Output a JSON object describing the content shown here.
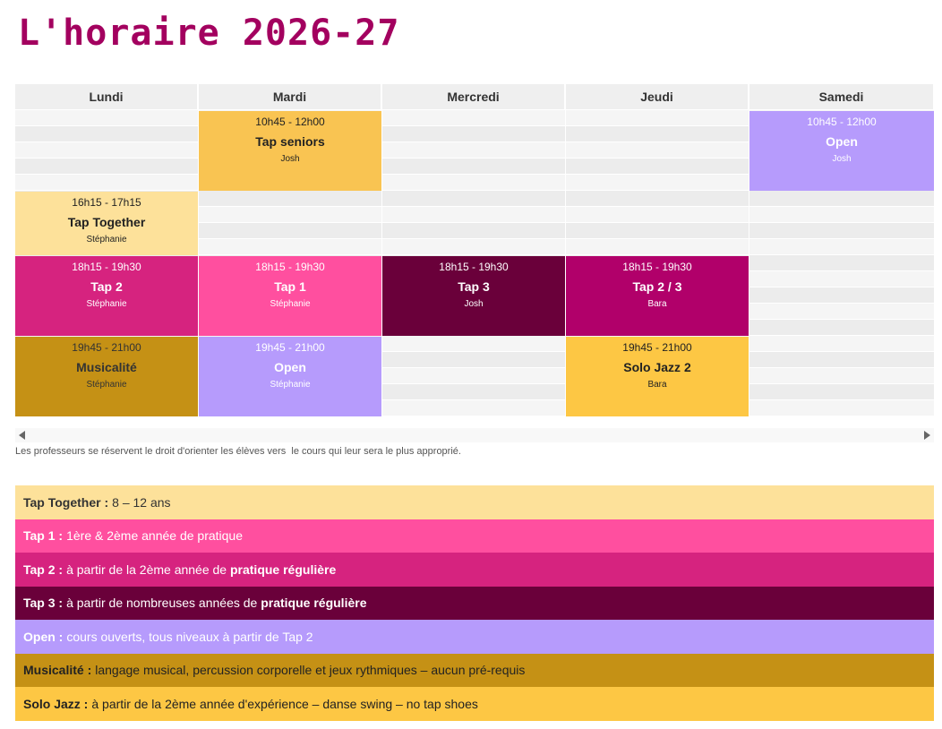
{
  "page": {
    "title": "L'horaire 2026-27"
  },
  "days": [
    "Lundi",
    "Mardi",
    "Mercredi",
    "Jeudi",
    "Samedi"
  ],
  "classes": [
    {
      "day": 1,
      "time": "10h45 - 12h00",
      "name": "Tap seniors",
      "teacher": "Josh",
      "bg": "#f9c452",
      "fg": "#222222"
    },
    {
      "day": 4,
      "time": "10h45 - 12h00",
      "name": "Open",
      "teacher": "Josh",
      "bg": "#b69bfc",
      "fg": "#ffffff"
    },
    {
      "day": 0,
      "time": "16h15 - 17h15",
      "name": "Tap Together",
      "teacher": "Stéphanie",
      "bg": "#fde19a",
      "fg": "#222222"
    },
    {
      "day": 0,
      "time": "18h15 - 19h30",
      "name": "Tap 2",
      "teacher": "Stéphanie",
      "bg": "#d6237f",
      "fg": "#ffffff"
    },
    {
      "day": 1,
      "time": "18h15 - 19h30",
      "name": "Tap 1",
      "teacher": "Stéphanie",
      "bg": "#ff4f9f",
      "fg": "#ffffff"
    },
    {
      "day": 2,
      "time": "18h15 - 19h30",
      "name": "Tap 3",
      "teacher": "Josh",
      "bg": "#6a003a",
      "fg": "#ffffff"
    },
    {
      "day": 3,
      "time": "18h15 - 19h30",
      "name": "Tap 2 / 3",
      "teacher": "Bara",
      "bg": "#b1006a",
      "fg": "#ffffff"
    },
    {
      "day": 0,
      "time": "19h45 - 21h00",
      "name": "Musicalité",
      "teacher": "Stéphanie",
      "bg": "#c59115",
      "fg": "#333333"
    },
    {
      "day": 1,
      "time": "19h45 - 21h00",
      "name": "Open",
      "teacher": "Stéphanie",
      "bg": "#b69bfc",
      "fg": "#ffffff"
    },
    {
      "day": 3,
      "time": "19h45 - 21h00",
      "name": "Solo Jazz 2",
      "teacher": "Bara",
      "bg": "#fdc744",
      "fg": "#222222"
    }
  ],
  "note": "Les professeurs se réservent le droit d'orienter les élèves vers  le cours qui leur sera le plus approprié.",
  "legend": [
    {
      "label": "Tap Together :",
      "parts": [
        "8 – 12 ans"
      ],
      "bg": "#fde19a",
      "fg": "#333333"
    },
    {
      "label": "Tap 1 :",
      "parts": [
        "1ère & 2ème année de pratique"
      ],
      "bg": "#ff4f9f",
      "fg": "#ffffff"
    },
    {
      "label": "Tap 2 :",
      "parts": [
        "à partir de la 2ème année de ",
        "pratique régulière"
      ],
      "bg": "#d6237f",
      "fg": "#ffffff"
    },
    {
      "label": "Tap 3 :",
      "parts": [
        "à partir de nombreuses années de ",
        "pratique régulière"
      ],
      "bg": "#6a003a",
      "fg": "#ffffff"
    },
    {
      "label": "Open :",
      "parts": [
        "cours ouverts, tous niveaux à partir de Tap 2"
      ],
      "bg": "#b69bfc",
      "fg": "#ffffff"
    },
    {
      "label": "Musicalité :",
      "parts": [
        "langage musical, percussion corporelle et jeux rythmiques – aucun pré-requis"
      ],
      "bg": "#c59115",
      "fg": "#222222"
    },
    {
      "label": "Solo Jazz :",
      "parts": [
        "à partir de la 2ème année d'expérience – danse swing – no tap shoes"
      ],
      "bg": "#fdc744",
      "fg": "#222222"
    }
  ],
  "colors": {
    "title": "#a3005f",
    "header_bg": "#efefef",
    "stripe_a": "#f5f5f5",
    "stripe_b": "#ececec"
  }
}
